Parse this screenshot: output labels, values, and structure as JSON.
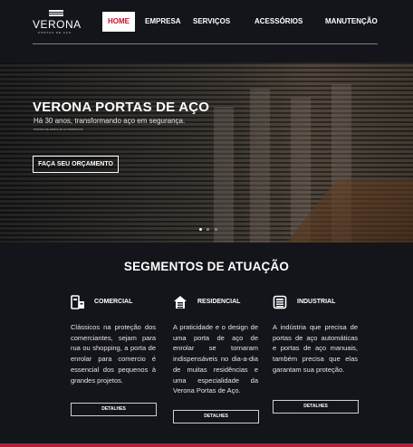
{
  "header": {
    "logo_name": "VERONA",
    "logo_sub": "PORTAS DE AÇO",
    "nav": [
      {
        "label": "HOME",
        "active": true
      },
      {
        "label": "EMPRESA",
        "active": false
      },
      {
        "label": "SERVIÇOS",
        "active": false
      },
      {
        "label": "ACESSÓRIOS",
        "active": false
      },
      {
        "label": "MANUTENÇÃO",
        "active": false
      }
    ]
  },
  "hero": {
    "title": "VERONA PORTAS DE AÇO",
    "subtitle": "Há 30 anos, transformando aço em segurança.",
    "tagline": "PORTAS DE ENROLAR AUTOMÁTICAS",
    "cta_label": "FAÇA SEU ORÇAMENTO",
    "slides": 3,
    "active_slide": 1
  },
  "segments": {
    "title": "SEGMENTOS DE ATUAÇÃO",
    "items": [
      {
        "icon": "shop-icon",
        "label": "COMERCIAL",
        "text": "Clássicos na proteção dos comerciantes, sejam para rua ou shopping, a porta de enrolar para comercio é essencial dos pequenos à grandes projetos.",
        "button": "DETALHES"
      },
      {
        "icon": "house-icon",
        "label": "RESIDENCIAL",
        "text": "A praticidade e o design de uma porta de aço de enrolar se tornaram indispensáveis no dia-a-dia de muitas residências e uma especialidade da Verona Portas de Aço.",
        "button": "DETALHES"
      },
      {
        "icon": "factory-icon",
        "label": "INDUSTRIAL",
        "text": "A indústria que precisa de portas de aço automáticas e portas de aço manuais, também precisa que elas garantam sua proteção.",
        "button": "DETALHES"
      }
    ]
  },
  "colors": {
    "background": "#14151a",
    "accent": "#c8102e",
    "bottom_bar": "#b21e35"
  }
}
